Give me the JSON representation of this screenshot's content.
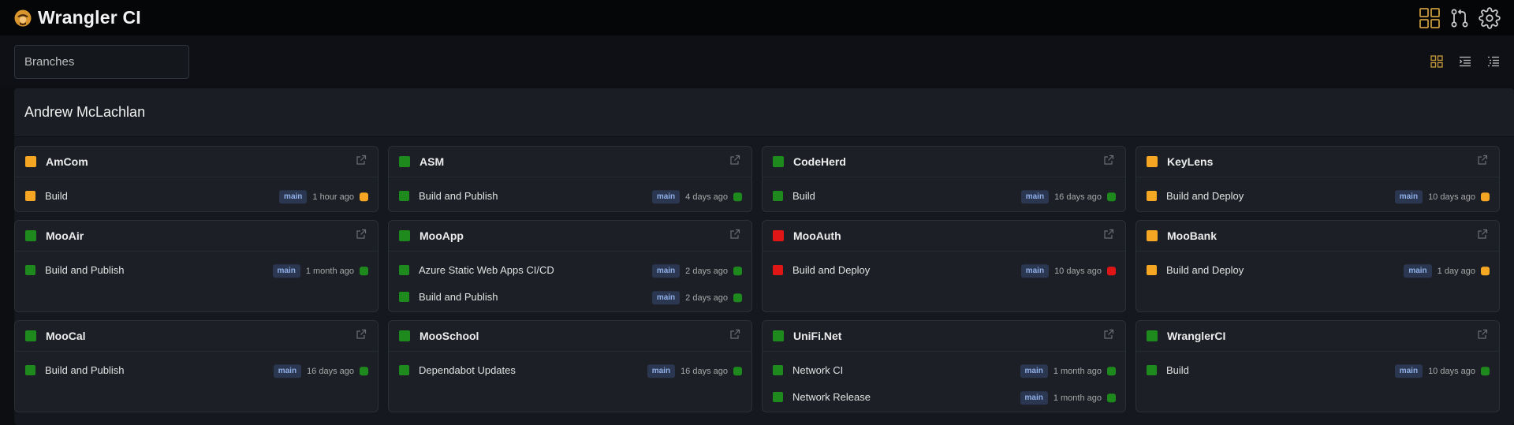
{
  "app": {
    "title": "Wrangler CI"
  },
  "colors": {
    "success": "#1e8a1e",
    "pending": "#f5a623",
    "failure": "#e01515",
    "accent": "#c89a3c"
  },
  "top_icons": [
    "dashboard-grid-icon",
    "pull-request-icon",
    "gear-icon"
  ],
  "branches_filter": {
    "placeholder": "Branches",
    "value": ""
  },
  "view_modes": [
    "grid-view-icon",
    "compact-list-icon",
    "list-view-icon"
  ],
  "group": {
    "owner": "Andrew McLachlan",
    "repos": [
      {
        "name": "AmCom",
        "status": "pending",
        "workflows": [
          {
            "name": "Build",
            "branch": "main",
            "time": "1 hour ago",
            "status": "pending"
          }
        ]
      },
      {
        "name": "ASM",
        "status": "success",
        "workflows": [
          {
            "name": "Build and Publish",
            "branch": "main",
            "time": "4 days ago",
            "status": "success"
          }
        ]
      },
      {
        "name": "CodeHerd",
        "status": "success",
        "workflows": [
          {
            "name": "Build",
            "branch": "main",
            "time": "16 days ago",
            "status": "success"
          }
        ]
      },
      {
        "name": "KeyLens",
        "status": "pending",
        "workflows": [
          {
            "name": "Build and Deploy",
            "branch": "main",
            "time": "10 days ago",
            "status": "pending"
          }
        ]
      },
      {
        "name": "MooAir",
        "status": "success",
        "workflows": [
          {
            "name": "Build and Publish",
            "branch": "main",
            "time": "1 month ago",
            "status": "success"
          }
        ]
      },
      {
        "name": "MooApp",
        "status": "success",
        "workflows": [
          {
            "name": "Azure Static Web Apps CI/CD",
            "branch": "main",
            "time": "2 days ago",
            "status": "success"
          },
          {
            "name": "Build and Publish",
            "branch": "main",
            "time": "2 days ago",
            "status": "success"
          }
        ]
      },
      {
        "name": "MooAuth",
        "status": "failure",
        "workflows": [
          {
            "name": "Build and Deploy",
            "branch": "main",
            "time": "10 days ago",
            "status": "failure"
          }
        ]
      },
      {
        "name": "MooBank",
        "status": "pending",
        "workflows": [
          {
            "name": "Build and Deploy",
            "branch": "main",
            "time": "1 day ago",
            "status": "pending"
          }
        ]
      },
      {
        "name": "MooCal",
        "status": "success",
        "workflows": [
          {
            "name": "Build and Publish",
            "branch": "main",
            "time": "16 days ago",
            "status": "success"
          }
        ]
      },
      {
        "name": "MooSchool",
        "status": "success",
        "workflows": [
          {
            "name": "Dependabot Updates",
            "branch": "main",
            "time": "16 days ago",
            "status": "success"
          }
        ]
      },
      {
        "name": "UniFi.Net",
        "status": "success",
        "workflows": [
          {
            "name": "Network CI",
            "branch": "main",
            "time": "1 month ago",
            "status": "success"
          },
          {
            "name": "Network Release",
            "branch": "main",
            "time": "1 month ago",
            "status": "success"
          }
        ]
      },
      {
        "name": "WranglerCI",
        "status": "success",
        "workflows": [
          {
            "name": "Build",
            "branch": "main",
            "time": "10 days ago",
            "status": "success"
          }
        ]
      }
    ]
  }
}
